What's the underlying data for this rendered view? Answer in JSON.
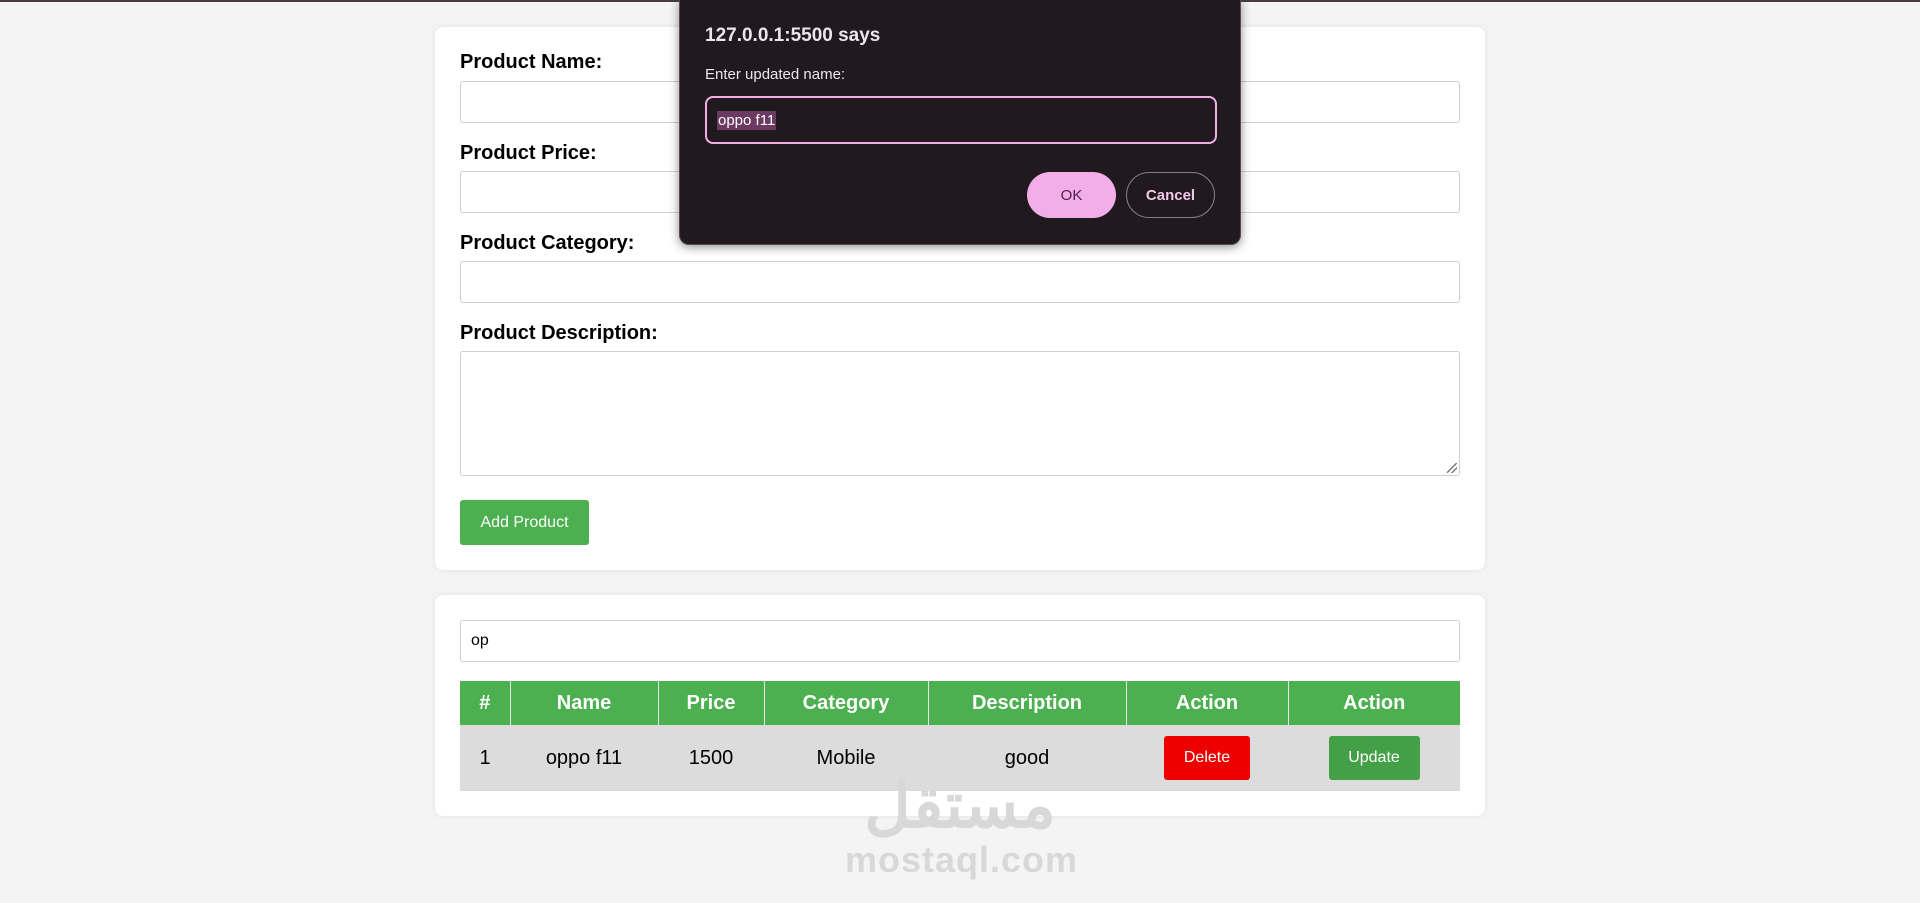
{
  "form": {
    "name_label": "Product Name:",
    "price_label": "Product Price:",
    "category_label": "Product Category:",
    "description_label": "Product Description:",
    "name_value": "",
    "price_value": "",
    "category_value": "",
    "add_button": "Add Product"
  },
  "list": {
    "search_value": "op",
    "columns": [
      "#",
      "Name",
      "Price",
      "Category",
      "Description",
      "Action",
      "Action"
    ],
    "rows": [
      {
        "index": "1",
        "name": "oppo f11",
        "price": "1500",
        "category": "Mobile",
        "description": "good",
        "delete_label": "Delete",
        "update_label": "Update"
      }
    ]
  },
  "dialog": {
    "title": "127.0.0.1:5500 says",
    "message": "Enter updated name:",
    "input_value": "oppo f11",
    "ok_label": "OK",
    "cancel_label": "Cancel"
  },
  "watermark": {
    "logo": "مستقل",
    "text": "mostaql.com"
  },
  "colors": {
    "accent_green": "#4caf50",
    "delete_red": "#ee0000",
    "dialog_bg": "#201a1e",
    "dialog_accent": "#f3ade8"
  }
}
